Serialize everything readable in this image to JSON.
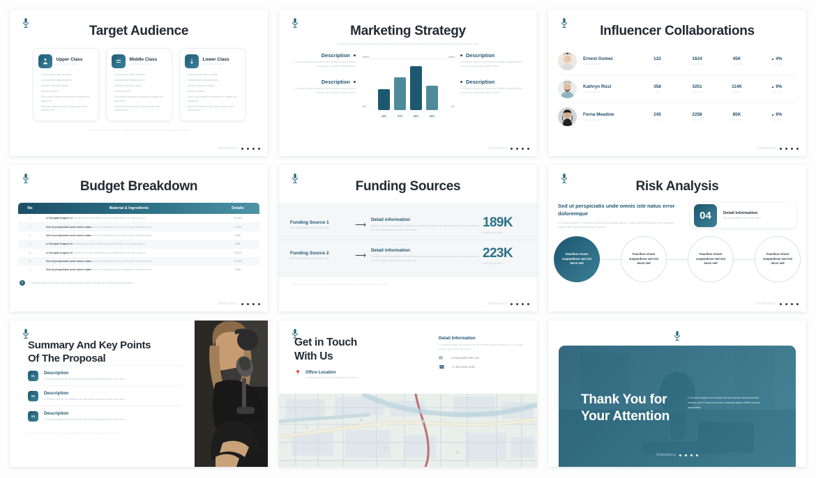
{
  "meta": {
    "watermark": "Slidesdocs"
  },
  "slides": {
    "target_audience": {
      "title": "Target Audience",
      "cards": [
        {
          "name": "Upper Class",
          "sub": "Lorem ipsum dolor",
          "icon": "person-icon",
          "bullets": [
            "Lorem ipsum dolor sit amet,",
            "Consectetuer adipiscing elit.",
            "Aenean commodo ligula",
            "Aenean massa.",
            "Cum sociis natoque penatibus et magnis dis parturient",
            "Nascetur ridiculus mus. Donec quam felis, ultricies nec."
          ]
        },
        {
          "name": "Middle Class",
          "sub": "Lorem ipsum dolor",
          "icon": "lines-icon",
          "bullets": [
            "Lorem ipsum dolor sit amet,",
            "Consectetuer adipiscing elit.",
            "Aenean commodo ligula",
            "Aenean massa.",
            "Cum sociis natoque penatibus et magnis dis parturient",
            "Nascetur ridiculus mus. Donec quam felis, ultricies nec."
          ]
        },
        {
          "name": "Lower Class",
          "sub": "Lorem ipsum dolor",
          "icon": "arrow-down-icon",
          "bullets": [
            "Lorem ipsum dolor sit amet,",
            "Consectetuer adipiscing elit.",
            "Aenean commodo ligula",
            "Aenean massa.",
            "Cum sociis natoque penatibus et magnis dis parturient",
            "Nascetur ridiculus mus. Donec quam felis, ultricies nec."
          ]
        }
      ],
      "footer": "Lorem ipsum dolor sit amet, consectetuer adipiscing elit nec commodo ligula eg amber"
    },
    "marketing_strategy": {
      "title": "Marketing Strategy",
      "subtitle": "Vulputate eu scelerisque felis imperdiet proin tristique senectus netus et malesuada fames turpis massa vitae tortor condimentum lorem",
      "descriptions": [
        {
          "heading": "Description",
          "text": "Li Europan lingues membres sam familie separat existent europa usa vocabular lingues differe"
        },
        {
          "heading": "Description",
          "text": "Li Europan lingues membres sam familie separat existent europa usa vocabular lingues differe"
        },
        {
          "heading": "Description",
          "text": "Li Europan lingues membres sam familie separat existent europa usa vocabular lingues differe"
        },
        {
          "heading": "Description",
          "text": "Li Europan lingues membres sam familie separat existent europa usa vocabular lingues differe"
        }
      ],
      "axis": {
        "top_left": "100%",
        "top_right": "100%",
        "bottom_left": "0%",
        "bottom_right": "0%"
      }
    },
    "influencer": {
      "title": "Influencer Collaborations",
      "columns": [
        "Famous influencer",
        "Post",
        "Avg. views",
        "Followers",
        "Eng. Rate"
      ],
      "rows": [
        {
          "name": "Ernest Gomez",
          "role": "Famous influencer",
          "posts": "122",
          "posts_label": "Post",
          "views": "1624",
          "views_label": "Avg. views",
          "followers": "45K",
          "followers_label": "Followers",
          "rate": "4%",
          "rate_label": "Eng. Rate"
        },
        {
          "name": "Kathryn Rizzi",
          "role": "Famous influencer",
          "posts": "358",
          "posts_label": "Post",
          "views": "3251",
          "views_label": "Avg. views",
          "followers": "114K",
          "followers_label": "Followers",
          "rate": "9%",
          "rate_label": "Eng. Rate"
        },
        {
          "name": "Ferna Meadow",
          "role": "Famous influencer",
          "posts": "245",
          "posts_label": "Post",
          "views": "2258",
          "views_label": "Avg. views",
          "followers": "85K",
          "followers_label": "Followers",
          "rate": "6%",
          "rate_label": "Eng. Rate"
        }
      ]
    },
    "budget": {
      "title": "Budget Breakdown",
      "headers": {
        "no": "No",
        "material": "Material & Ingredients",
        "details": "Details"
      },
      "rows": [
        {
          "no": "1",
          "bold": "Li Europan lingues es",
          "rest": "membres del sam familie separat existentie es un myth musica",
          "details": "13-19K"
        },
        {
          "no": "2",
          "bold": "Sed ut perspiciatis unde omnis natus",
          "rest": "error sit voluptatem accu doloremque laudant eaque",
          "details": "2-2.9K"
        },
        {
          "no": "3",
          "bold": "Sed ut perspiciatis unde omnis natus",
          "rest": "error sit voluptatem accu doloremque laudant eaque",
          "details": "328K"
        },
        {
          "no": "4",
          "bold": "Li Europan lingues es",
          "rest": "membres del sam familie separat existentie es un myth musica",
          "details": "498K"
        },
        {
          "no": "5",
          "bold": "Li Europan lingues es",
          "rest": "membres del sam familie separat existentie es un myth musica",
          "details": "778.2K"
        },
        {
          "no": "6",
          "bold": "Sed ut perspiciatis unde omnis natus",
          "rest": "error sit voluptatem accu doloremque laudant eaque",
          "details": "13-15K"
        },
        {
          "no": "7",
          "bold": "Sed ut perspiciatis unde omnis natus",
          "rest": "error sit voluptatem accu doloremque laudant eaque",
          "details": "235K"
        }
      ],
      "note_icon": "info-icon",
      "note": "Li Europan lingues membres sam familie separat existent europa usa vocabular lingues differe"
    },
    "funding": {
      "title": "Funding Sources",
      "rows": [
        {
          "source": "Funding Source 1",
          "source_sub": "Sed ut perspiciatis unde omnis natus",
          "detail_h": "Detail information",
          "detail_p": "Faucibus ornare suspendisse sed nisi lacus sed viverra. Massa eget egestas purus viverra accumsan in nisl nisi. Vehicula ipsum a arcu cursus vitae.",
          "value": "189K",
          "value_sub": "Lorem ipsum dolor"
        },
        {
          "source": "Funding Source 2",
          "source_sub": "Sed ut perspiciatis unde omnis natus",
          "detail_h": "Detail information",
          "detail_p": "Faucibus ornare suspendisse sed nisi lacus sed viverra. Massa eget egestas purus viverra accumsan in nisl nisi. Vehicula ipsum a arcu cursus vitae.",
          "value": "223K",
          "value_sub": "Lorem ipsum dolor"
        }
      ],
      "footer": "Lorem ipsum dolor sit amet, consectetuer adipiscing elit nec commodo ligula eg ramen"
    },
    "risk": {
      "title": "Risk Analysis",
      "heading": "Sed ut perspiciatis unde omnis iste natus error doloremque",
      "paragraph": "Li Europan lingues es membres del sam familie separat scientie, musica, sport Europa usa li sam vocabular lingues differe solmen grammatica commun",
      "badge_number": "04",
      "card_heading": "Detail Information",
      "card_sub": "Sed ut perspiciatis unde omnis natus",
      "circles": [
        "Faucibus ornare suspendisse sed nisi lacus sed",
        "Faucibus ornare suspendisse sed nisi lacus sed",
        "Faucibus ornare suspendisse sed nisi lacus sed",
        "Faucibus ornare suspendisse sed nisi lacus sed"
      ]
    },
    "summary": {
      "title_line1": "Summary And Key Points",
      "title_line2": "Of The Proposal",
      "items": [
        {
          "num": "01",
          "heading": "Description",
          "text": "Li Europan lingues es membres del sam familie separat scientie usa li sam"
        },
        {
          "num": "02",
          "heading": "Description",
          "text": "Li Europan lingues es membres del sam familie separat scientie usa li sam"
        },
        {
          "num": "03",
          "heading": "Description",
          "text": "Li Europan lingues es membres del sam familie separat scientie usa li sam"
        }
      ],
      "footer": "Lorem ipsum dolor sit amet, consectetuer adipiscing elit nec commodo ligula eg amber",
      "photo_alt": "woman-with-microphone-photo"
    },
    "contact": {
      "title_line1": "Get in Touch",
      "title_line2": "With Us",
      "office_heading": "Office Location",
      "office_text": "Lorem ipsum dolor sit amet consectetuer eiusmod",
      "detail_heading": "Detail Information",
      "detail_text": "Li Europan lingues es membres del sam familie separat existentie es un scientie, musica, sport usa li sam differe",
      "email": "company@email.com",
      "phone": "+1 353 2345 2235",
      "map_alt": "city-street-map"
    },
    "thanks": {
      "title_line1": "Thank You for",
      "title_line2": "Your Attention",
      "paragraph": "Li Europan lingues es membres del sam familie separat scientie, musica, sport Europa usa li sam vocabular lingues differe solmen grammatica"
    }
  },
  "chart_data": {
    "type": "bar",
    "title": "Marketing Strategy",
    "categories": [
      "43%",
      "67%",
      "89%",
      "50%"
    ],
    "values": [
      43,
      67,
      89,
      50
    ],
    "colors": [
      "#1d5871",
      "#4f8a9c",
      "#1d5871",
      "#4f8a9c"
    ],
    "xlabel": "",
    "ylabel": "",
    "ylim": [
      0,
      100
    ],
    "grid": false,
    "legend": "none",
    "axis_labels": {
      "left_top": "100%",
      "left_bottom": "0%",
      "right_top": "100%",
      "right_bottom": "0%"
    }
  }
}
